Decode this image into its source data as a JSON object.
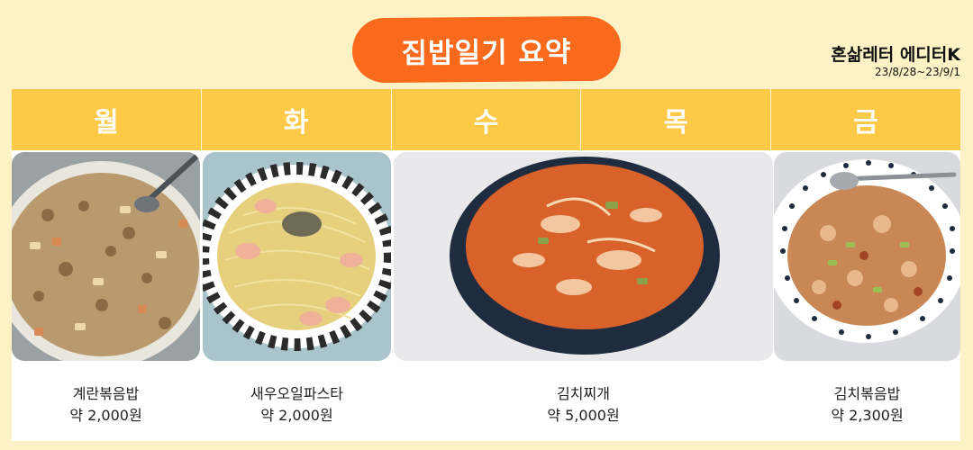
{
  "title": "집밥일기 요약",
  "editor": {
    "name": "혼삶레터 에디터K",
    "period": "23/8/28~23/9/1"
  },
  "days": [
    "월",
    "화",
    "수",
    "목",
    "금"
  ],
  "meals": [
    {
      "name": "계란볶음밥",
      "price": "약 2,000원"
    },
    {
      "name": "새우오일파스타",
      "price": "약 2,000원"
    },
    {
      "name": "김치찌개",
      "price": "약 5,000원"
    },
    {
      "name": "김치볶음밥",
      "price": "약 2,300원"
    }
  ],
  "colors": {
    "background": "#fdf2c6",
    "accent": "#fa6a1d",
    "header": "#fdc947"
  }
}
